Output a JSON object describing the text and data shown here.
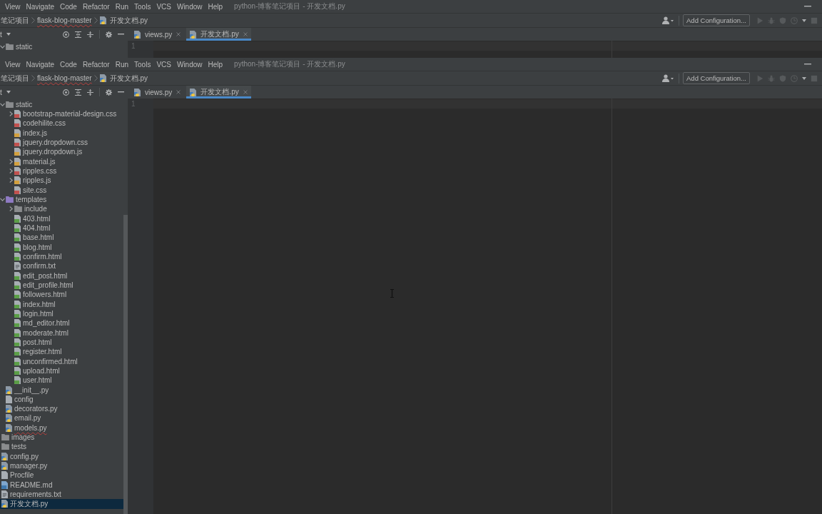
{
  "windows": [
    {
      "menu": [
        "View",
        "Navigate",
        "Code",
        "Refactor",
        "Run",
        "Tools",
        "VCS",
        "Window",
        "Help"
      ],
      "title": "python-博客笔记项目 - 开发文档.py",
      "breadcrumb": [
        {
          "label": "笔记项目",
          "kind": "dir",
          "error": false
        },
        {
          "label": "flask-blog-master",
          "kind": "dir",
          "error": true
        },
        {
          "label": "开发文档.py",
          "kind": "py",
          "error": false
        }
      ],
      "run_config": {
        "label": "Add Configuration..."
      },
      "run_actions": [
        {
          "kind": "run",
          "disabled": true
        },
        {
          "kind": "debug",
          "disabled": true
        },
        {
          "kind": "coverage",
          "disabled": true
        },
        {
          "kind": "profile",
          "disabled": true
        },
        {
          "kind": "menu",
          "disabled": false
        },
        {
          "kind": "stop",
          "disabled": true
        }
      ],
      "panel": {
        "label": "t"
      },
      "tabs": [
        {
          "label": "views.py",
          "kind": "py",
          "selected": false
        },
        {
          "label": "开发文档.py",
          "kind": "py",
          "selected": true
        }
      ],
      "line_numbers": [
        "1"
      ],
      "tree": [
        {
          "children": [
            {
              "label": "static",
              "kind": "folder",
              "color": "#8a8c8e",
              "expanded": true,
              "selected": false,
              "error": false
            }
          ]
        }
      ]
    },
    {
      "menu": [
        "View",
        "Navigate",
        "Code",
        "Refactor",
        "Run",
        "Tools",
        "VCS",
        "Window",
        "Help"
      ],
      "title": "python-博客笔记项目 - 开发文档.py",
      "breadcrumb": [
        {
          "label": "笔记项目",
          "kind": "dir",
          "error": false
        },
        {
          "label": "flask-blog-master",
          "kind": "dir",
          "error": true
        },
        {
          "label": "开发文档.py",
          "kind": "py",
          "error": false
        }
      ],
      "run_config": {
        "label": "Add Configuration..."
      },
      "run_actions": [
        {
          "kind": "run",
          "disabled": true
        },
        {
          "kind": "debug",
          "disabled": true
        },
        {
          "kind": "coverage",
          "disabled": true
        },
        {
          "kind": "profile",
          "disabled": true
        },
        {
          "kind": "menu",
          "disabled": false
        },
        {
          "kind": "stop",
          "disabled": true
        }
      ],
      "panel": {
        "label": "t"
      },
      "tabs": [
        {
          "label": "views.py",
          "kind": "py",
          "selected": false
        },
        {
          "label": "开发文档.py",
          "kind": "py",
          "selected": true
        }
      ],
      "line_numbers": [
        "1"
      ],
      "tree": [
        {
          "children": [
            {
              "label": "static",
              "kind": "folder",
              "color": "#8a8c8e",
              "expanded": true,
              "selected": false,
              "error": false,
              "children": [
                {
                  "label": "bootstrap-material-design.css",
                  "kind": "css",
                  "expanded": false,
                  "selected": false,
                  "error": false
                },
                {
                  "label": "codehilite.css",
                  "kind": "css",
                  "selected": false,
                  "error": false
                },
                {
                  "label": "index.js",
                  "kind": "js",
                  "selected": false,
                  "error": false
                },
                {
                  "label": "jquery.dropdown.css",
                  "kind": "css",
                  "selected": false,
                  "error": false
                },
                {
                  "label": "jquery.dropdown.js",
                  "kind": "js",
                  "selected": false,
                  "error": false
                },
                {
                  "label": "material.js",
                  "kind": "js",
                  "expanded": false,
                  "selected": false,
                  "error": false
                },
                {
                  "label": "ripples.css",
                  "kind": "css",
                  "expanded": false,
                  "selected": false,
                  "error": false
                },
                {
                  "label": "ripples.js",
                  "kind": "js",
                  "expanded": false,
                  "selected": false,
                  "error": false
                },
                {
                  "label": "site.css",
                  "kind": "css",
                  "selected": false,
                  "error": false
                }
              ]
            },
            {
              "label": "templates",
              "kind": "folder",
              "color": "#8f7bc4",
              "expanded": true,
              "selected": false,
              "error": false,
              "children": [
                {
                  "label": "include",
                  "kind": "folder",
                  "color": "#8a8c8e",
                  "expanded": false,
                  "selected": false,
                  "error": false
                },
                {
                  "label": "403.html",
                  "kind": "html",
                  "selected": false,
                  "error": false
                },
                {
                  "label": "404.html",
                  "kind": "html",
                  "selected": false,
                  "error": false
                },
                {
                  "label": "base.html",
                  "kind": "html",
                  "selected": false,
                  "error": false
                },
                {
                  "label": "blog.html",
                  "kind": "html",
                  "selected": false,
                  "error": false
                },
                {
                  "label": "confirm.html",
                  "kind": "html",
                  "selected": false,
                  "error": false
                },
                {
                  "label": "confirm.txt",
                  "kind": "txt",
                  "selected": false,
                  "error": false
                },
                {
                  "label": "edit_post.html",
                  "kind": "html",
                  "selected": false,
                  "error": false
                },
                {
                  "label": "edit_profile.html",
                  "kind": "html",
                  "selected": false,
                  "error": false
                },
                {
                  "label": "followers.html",
                  "kind": "html",
                  "selected": false,
                  "error": false
                },
                {
                  "label": "index.html",
                  "kind": "html",
                  "selected": false,
                  "error": false
                },
                {
                  "label": "login.html",
                  "kind": "html",
                  "selected": false,
                  "error": false
                },
                {
                  "label": "md_editor.html",
                  "kind": "html",
                  "selected": false,
                  "error": false
                },
                {
                  "label": "moderate.html",
                  "kind": "html",
                  "selected": false,
                  "error": false
                },
                {
                  "label": "post.html",
                  "kind": "html",
                  "selected": false,
                  "error": false
                },
                {
                  "label": "register.html",
                  "kind": "html",
                  "selected": false,
                  "error": false
                },
                {
                  "label": "unconfirmed.html",
                  "kind": "html",
                  "selected": false,
                  "error": false
                },
                {
                  "label": "upload.html",
                  "kind": "html",
                  "selected": false,
                  "error": false
                },
                {
                  "label": "user.html",
                  "kind": "html",
                  "selected": false,
                  "error": false
                }
              ]
            },
            {
              "label": "__init__.py",
              "kind": "py",
              "selected": false,
              "error": false
            },
            {
              "label": "config",
              "kind": "file",
              "selected": false,
              "error": false
            },
            {
              "label": "decorators.py",
              "kind": "py",
              "selected": false,
              "error": false
            },
            {
              "label": "email.py",
              "kind": "py",
              "selected": false,
              "error": false
            },
            {
              "label": "models.py",
              "kind": "py",
              "selected": false,
              "error": true
            }
          ]
        },
        {
          "label": "images",
          "kind": "folder",
          "color": "#8a8c8e",
          "selected": false,
          "error": false
        },
        {
          "label": "tests",
          "kind": "folder",
          "color": "#8a8c8e",
          "selected": false,
          "error": false
        },
        {
          "label": "config.py",
          "kind": "py",
          "selected": false,
          "error": false
        },
        {
          "label": "manager.py",
          "kind": "py",
          "selected": false,
          "error": false
        },
        {
          "label": "Procfile",
          "kind": "file",
          "selected": false,
          "error": false
        },
        {
          "label": "README.md",
          "kind": "md",
          "selected": false,
          "error": false
        },
        {
          "label": "requirements.txt",
          "kind": "txt",
          "selected": false,
          "error": false
        },
        {
          "label": "开发文档.py",
          "kind": "py",
          "selected": true,
          "error": false
        }
      ]
    }
  ]
}
